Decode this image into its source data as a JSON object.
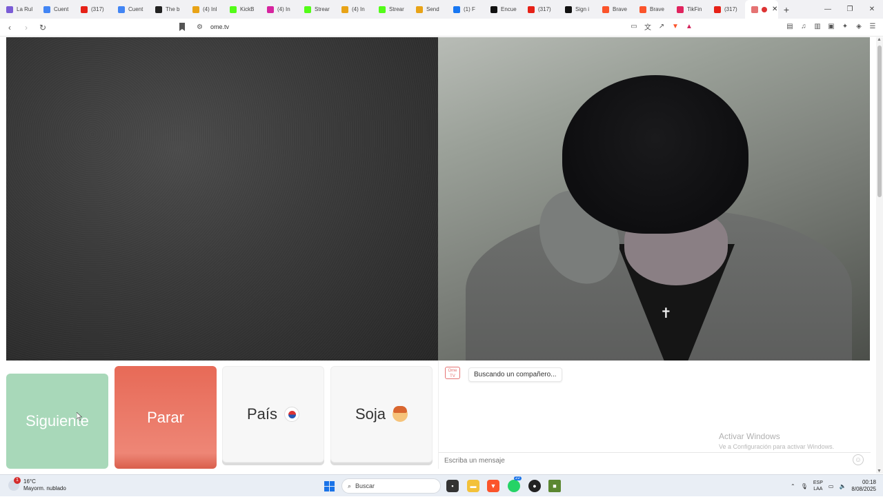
{
  "browser": {
    "tabs": [
      {
        "label": "La Rul",
        "color": "#7a5cd6"
      },
      {
        "label": "Cuent",
        "color": "#4285f4"
      },
      {
        "label": "(317) ",
        "color": "#e62117"
      },
      {
        "label": "Cuent",
        "color": "#4285f4"
      },
      {
        "label": "The b",
        "color": "#222222"
      },
      {
        "label": "(4) Inl",
        "color": "#e8a317"
      },
      {
        "label": "KickB",
        "color": "#53fc18"
      },
      {
        "label": "(4) In",
        "color": "#d6249f"
      },
      {
        "label": "Strear",
        "color": "#53fc18"
      },
      {
        "label": "(4) In",
        "color": "#e8a317"
      },
      {
        "label": "Strear",
        "color": "#53fc18"
      },
      {
        "label": "Send",
        "color": "#e8a317"
      },
      {
        "label": "(1) F",
        "color": "#1877f2"
      },
      {
        "label": "Encue",
        "color": "#111111"
      },
      {
        "label": "(317)",
        "color": "#e62117"
      },
      {
        "label": "Sign i",
        "color": "#111111"
      },
      {
        "label": "Brave",
        "color": "#fb542b"
      },
      {
        "label": "Brave",
        "color": "#fb542b"
      },
      {
        "label": "TikFin",
        "color": "#e0245e"
      },
      {
        "label": "(317)",
        "color": "#e62117"
      }
    ],
    "active_tab": {
      "label": "",
      "color": "#e57373"
    },
    "url": "ome.tv"
  },
  "app": {
    "buttons": {
      "next": "Siguiente",
      "stop": "Parar",
      "country": "País",
      "gender": "Soja"
    },
    "chat": {
      "logo_text": "Ome TV",
      "status_message": "Buscando un compañero...",
      "input_placeholder": "Escriba un mensaje"
    },
    "watermark": {
      "title": "Activar Windows",
      "subtitle": "Ve a Configuración para activar Windows."
    }
  },
  "taskbar": {
    "weather_temp": "16°C",
    "weather_desc": "Mayorm. nublado",
    "weather_badge": "1",
    "search_label": "Buscar",
    "whatsapp_badge": "22",
    "lang_top": "ESP",
    "lang_bottom": "LAA",
    "time": "00:18",
    "date": "8/08/2025"
  }
}
